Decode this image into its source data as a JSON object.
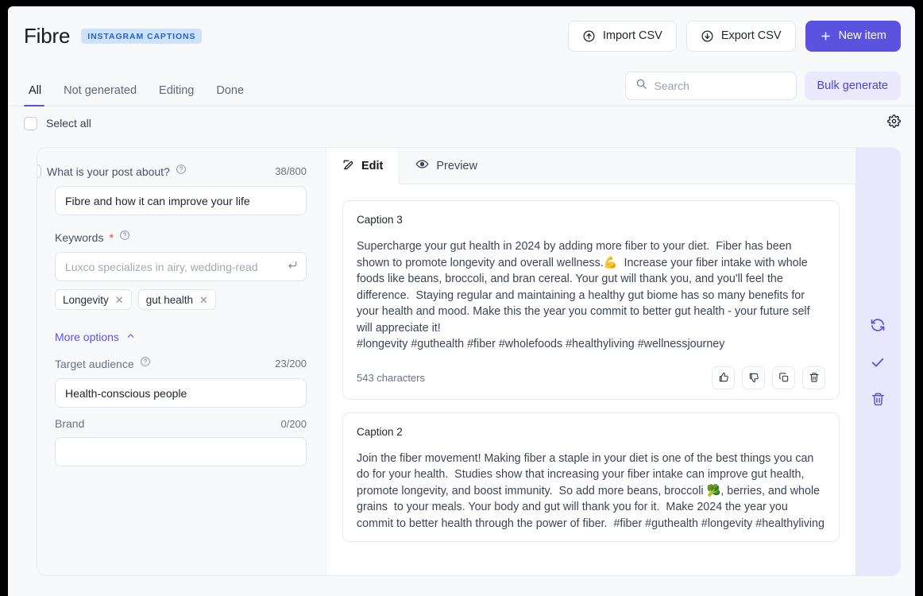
{
  "header": {
    "title": "Fibre",
    "badge": "INSTAGRAM CAPTIONS",
    "import_label": "Import CSV",
    "export_label": "Export CSV",
    "new_item_label": "New item",
    "import_icon": "upload-circle-icon",
    "export_icon": "download-circle-icon",
    "new_item_icon": "plus-icon",
    "primary_color": "#5b53e0",
    "badge_bg": "#cfe2fd",
    "badge_color": "#2563c9"
  },
  "tabs": [
    {
      "label": "All",
      "active": true
    },
    {
      "label": "Not generated",
      "active": false
    },
    {
      "label": "Editing",
      "active": false
    },
    {
      "label": "Done",
      "active": false
    }
  ],
  "search": {
    "placeholder": "Search",
    "value": "",
    "icon": "search-icon"
  },
  "bulk_generate_label": "Bulk generate",
  "select_all": {
    "label": "Select all",
    "checked": false
  },
  "settings_icon": "gear-icon",
  "form": {
    "post_about": {
      "label": "What is your post about?",
      "help_icon": "help-circle-icon",
      "counter": "38/800",
      "value": "Fibre and how it can improve your life",
      "placeholder": ""
    },
    "keywords": {
      "label": "Keywords",
      "required": "*",
      "help_icon": "help-circle-icon",
      "placeholder": "Luxco specializes in airy, wedding-read",
      "value": "",
      "enter_icon": "enter-return-icon",
      "tags": [
        "Longevity",
        "gut health"
      ]
    },
    "more_options": {
      "label": "More options",
      "icon": "chevron-up-icon",
      "expanded": true
    },
    "target_audience": {
      "label": "Target audience",
      "help_icon": "help-circle-icon",
      "counter": "23/200",
      "value": "Health-conscious people",
      "placeholder": ""
    },
    "brand": {
      "label": "Brand",
      "counter": "0/200",
      "value": "",
      "placeholder": ""
    }
  },
  "editor": {
    "tabs": [
      {
        "label": "Edit",
        "icon": "pencil-square-icon",
        "active": true
      },
      {
        "label": "Preview",
        "icon": "eye-icon",
        "active": false
      }
    ],
    "captions": [
      {
        "title": "Caption 3",
        "text": "Supercharge your gut health in 2024 by adding more fiber to your diet.  Fiber has been shown to promote longevity and overall wellness.💪  Increase your fiber intake with whole foods like beans, broccoli, and bran cereal. Your gut will thank you, and you'll feel the difference.  Staying regular and maintaining a healthy gut biome has so many benefits for your health and mood. Make this the year you commit to better gut health - your future self will appreciate it!\n#longevity #guthealth #fiber #wholefoods #healthyliving #wellnessjourney",
        "char_count": "543 characters",
        "actions": [
          {
            "name": "thumbs-up-icon"
          },
          {
            "name": "thumbs-down-icon"
          },
          {
            "name": "copy-icon"
          },
          {
            "name": "trash-icon"
          }
        ]
      },
      {
        "title": "Caption 2",
        "text": "Join the fiber movement! Making fiber a staple in your diet is one of the best things you can do for your health.  Studies show that increasing your fiber intake can improve gut health, promote longevity, and boost immunity.  So add more beans, broccoli 🥦, berries, and whole grains  to your meals. Your body and gut will thank you for it.  Make 2024 the year you commit to better health through the power of fiber.  #fiber #guthealth #longevity #healthyliving",
        "char_count": "",
        "actions": []
      }
    ]
  },
  "rail": {
    "background": "#e9e7fb",
    "color": "#5b53e0",
    "buttons": [
      {
        "name": "regenerate-icon"
      },
      {
        "name": "approve-check-icon"
      },
      {
        "name": "delete-item-icon"
      }
    ]
  }
}
